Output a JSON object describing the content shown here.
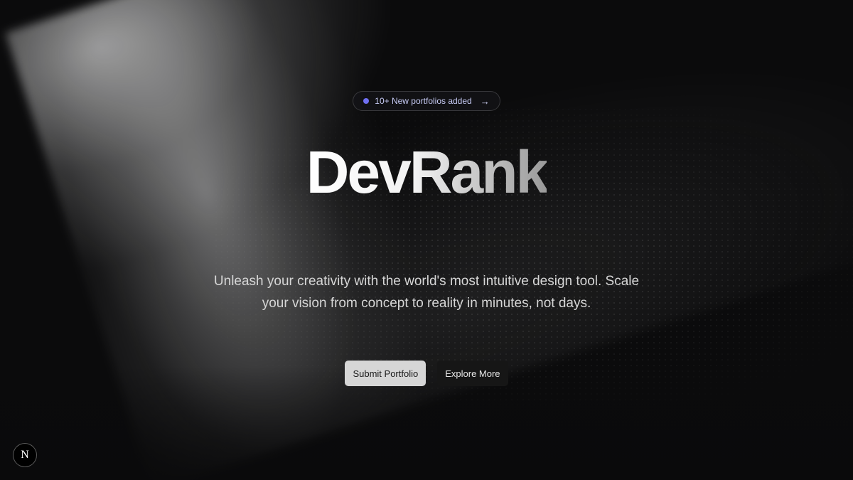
{
  "badge": {
    "text": "10+ New portfolios added",
    "arrow_icon": "arrow-right-icon",
    "dot_color": "#6f6ff2"
  },
  "hero": {
    "title": "DevRank",
    "subtitle": "Unleash your creativity with the world's most intuitive design tool. Scale your vision from concept to reality in minutes, not days."
  },
  "actions": {
    "primary_label": "Submit Portfolio",
    "secondary_label": "Explore More"
  },
  "dev_indicator": {
    "icon": "nextjs-icon",
    "glyph": "N"
  }
}
